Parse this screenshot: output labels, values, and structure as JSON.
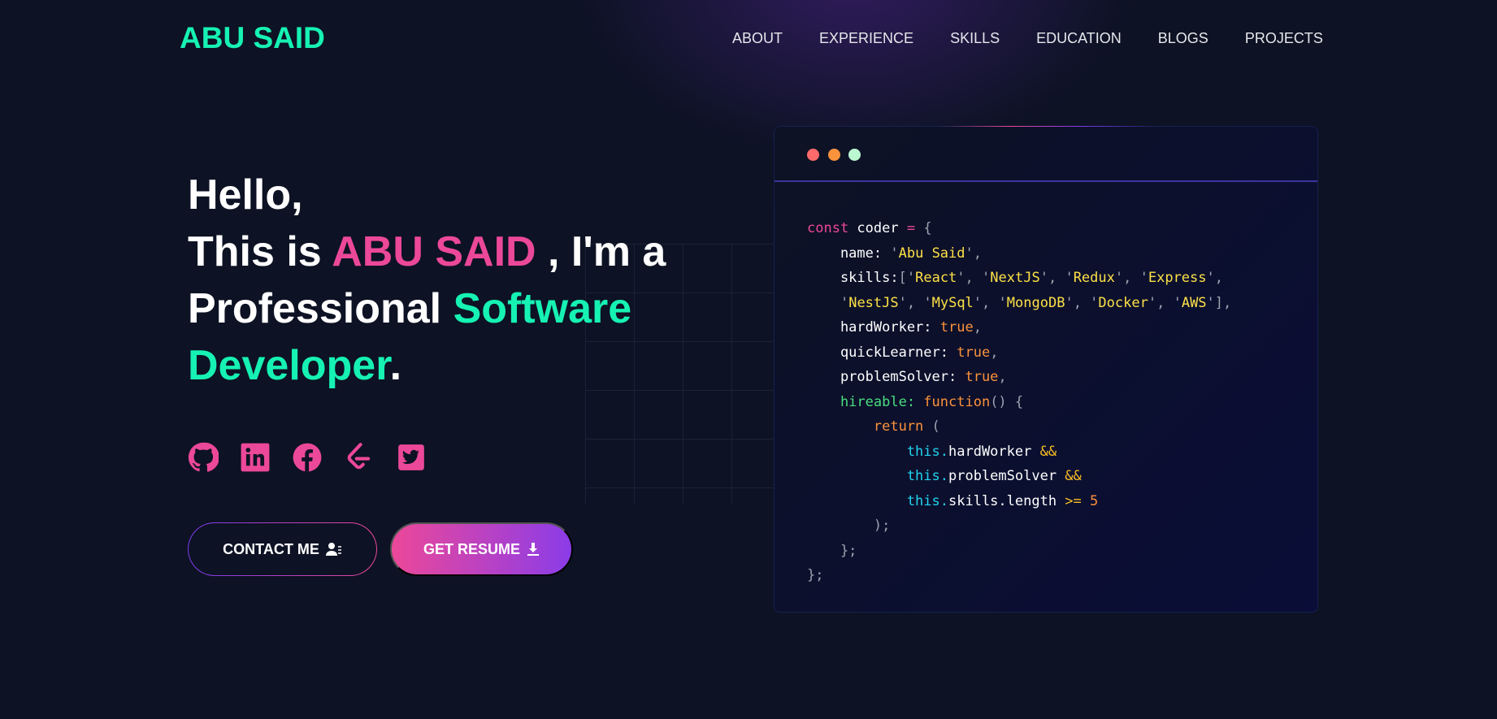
{
  "logo": "ABU SAID",
  "nav": [
    "ABOUT",
    "EXPERIENCE",
    "SKILLS",
    "EDUCATION",
    "BLOGS",
    "PROJECTS"
  ],
  "hero": {
    "line1": "Hello,",
    "line2a": "This is ",
    "name": "ABU SAID",
    "line2b": " , I'm a",
    "line3": "Professional ",
    "role1": "Software",
    "role2": "Developer",
    "period": "."
  },
  "socials": [
    "github-icon",
    "linkedin-icon",
    "facebook-icon",
    "leetcode-icon",
    "twitter-icon"
  ],
  "buttons": {
    "contact": "CONTACT ME",
    "resume": "GET RESUME"
  },
  "colors": {
    "accent_green": "#16f2b3",
    "accent_pink": "#ec4899",
    "accent_purple": "#7c3aed",
    "background": "#0d1224"
  },
  "window_dots": [
    "#ff6b6b",
    "#fb923c",
    "#bbf7d0"
  ],
  "code": [
    [
      [
        "kw",
        "const"
      ],
      [
        "pl",
        " coder "
      ],
      [
        "op",
        "="
      ],
      [
        "br",
        " {"
      ]
    ],
    [
      [
        "pl",
        "    name"
      ],
      [
        "pl",
        ": "
      ],
      [
        "q",
        "'"
      ],
      [
        "str",
        "Abu Said"
      ],
      [
        "q",
        "'"
      ],
      [
        "br",
        ","
      ]
    ],
    [
      [
        "pl",
        "    skills"
      ],
      [
        "pl",
        ":"
      ],
      [
        "br",
        "["
      ],
      [
        "q",
        "'"
      ],
      [
        "str",
        "React"
      ],
      [
        "q",
        "'"
      ],
      [
        "br",
        ", "
      ],
      [
        "q",
        "'"
      ],
      [
        "str",
        "NextJS"
      ],
      [
        "q",
        "'"
      ],
      [
        "br",
        ", "
      ],
      [
        "q",
        "'"
      ],
      [
        "str",
        "Redux"
      ],
      [
        "q",
        "'"
      ],
      [
        "br",
        ", "
      ],
      [
        "q",
        "'"
      ],
      [
        "str",
        "Express"
      ],
      [
        "q",
        "'"
      ],
      [
        "br",
        ","
      ]
    ],
    [
      [
        "pl",
        "    "
      ],
      [
        "q",
        "'"
      ],
      [
        "str",
        "NestJS"
      ],
      [
        "q",
        "'"
      ],
      [
        "br",
        ", "
      ],
      [
        "q",
        "'"
      ],
      [
        "str",
        "MySql"
      ],
      [
        "q",
        "'"
      ],
      [
        "br",
        ", "
      ],
      [
        "q",
        "'"
      ],
      [
        "str",
        "MongoDB"
      ],
      [
        "q",
        "'"
      ],
      [
        "br",
        ", "
      ],
      [
        "q",
        "'"
      ],
      [
        "str",
        "Docker"
      ],
      [
        "q",
        "'"
      ],
      [
        "br",
        ", "
      ],
      [
        "q",
        "'"
      ],
      [
        "str",
        "AWS"
      ],
      [
        "q",
        "'"
      ],
      [
        "br",
        "],"
      ]
    ],
    [
      [
        "pl",
        "    hardWorker: "
      ],
      [
        "bool",
        "true"
      ],
      [
        "br",
        ","
      ]
    ],
    [
      [
        "pl",
        "    quickLearner: "
      ],
      [
        "bool",
        "true"
      ],
      [
        "br",
        ","
      ]
    ],
    [
      [
        "pl",
        "    problemSolver: "
      ],
      [
        "bool",
        "true"
      ],
      [
        "br",
        ","
      ]
    ],
    [
      [
        "prop",
        "    hireable: "
      ],
      [
        "fn",
        "function"
      ],
      [
        "br",
        "() {"
      ]
    ],
    [
      [
        "fn",
        "        return"
      ],
      [
        "br",
        " ("
      ]
    ],
    [
      [
        "this",
        "            this."
      ],
      [
        "pl",
        "hardWorker "
      ],
      [
        "amp",
        "&&"
      ]
    ],
    [
      [
        "this",
        "            this."
      ],
      [
        "pl",
        "problemSolver "
      ],
      [
        "amp",
        "&&"
      ]
    ],
    [
      [
        "this",
        "            this."
      ],
      [
        "pl",
        "skills.length "
      ],
      [
        "amp",
        ">="
      ],
      [
        "num",
        " 5"
      ]
    ],
    [
      [
        "br",
        "        );"
      ]
    ],
    [
      [
        "br",
        "    };"
      ]
    ],
    [
      [
        "br",
        "};"
      ]
    ]
  ]
}
